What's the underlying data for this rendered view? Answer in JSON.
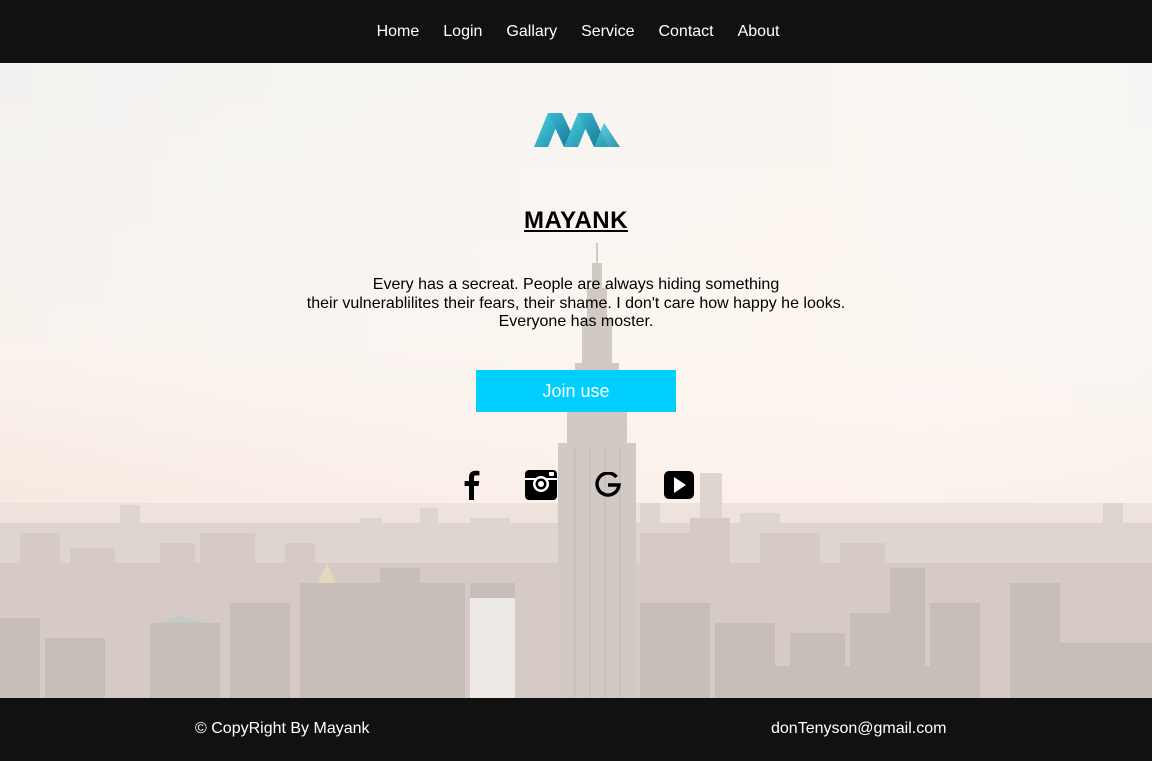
{
  "nav": {
    "items": [
      {
        "label": "Home"
      },
      {
        "label": "Login"
      },
      {
        "label": "Gallary"
      },
      {
        "label": "Service"
      },
      {
        "label": "Contact"
      },
      {
        "label": "About"
      }
    ]
  },
  "hero": {
    "logo_icon": "mm-logo-icon",
    "title": "MAYANK",
    "text_lines": [
      "Every has a secreat. People are always hiding something",
      "their vulnerablilites their fears, their shame. I don't care how happy he looks.",
      "Everyone has moster."
    ],
    "button_label": "Join use",
    "social_icons": [
      "facebook-icon",
      "instagram-icon",
      "google-icon",
      "youtube-icon"
    ]
  },
  "footer": {
    "copyright": "© CopyRight By Mayank",
    "email": "donTenyson@gmail.com"
  },
  "colors": {
    "nav_bg": "#111111",
    "accent": "#00cfff",
    "logo": "#29b6cf"
  }
}
